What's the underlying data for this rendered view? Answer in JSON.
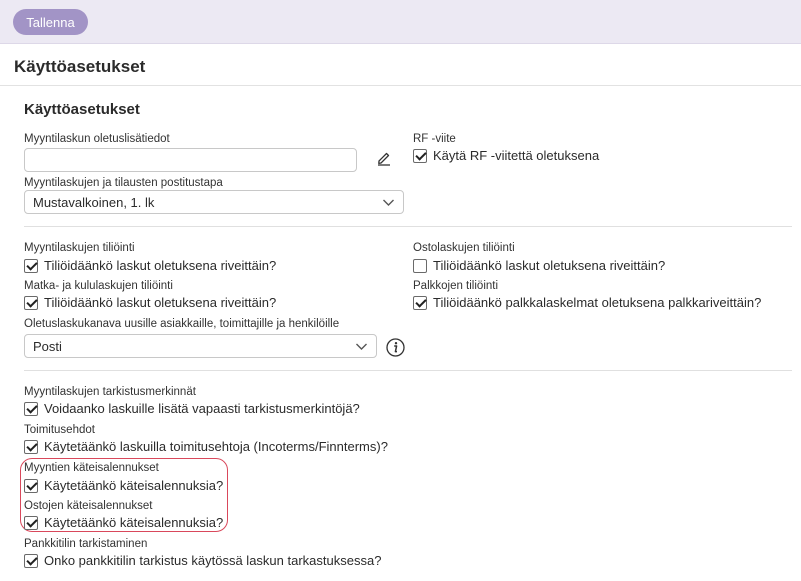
{
  "toolbar": {
    "save_label": "Tallenna"
  },
  "page": {
    "title": "Käyttöasetukset"
  },
  "section": {
    "title": "Käyttöasetukset"
  },
  "invoice_defaults": {
    "additional_info_label": "Myyntilaskun oletuslisätiedot",
    "additional_info_value": "",
    "postal_method_label": "Myyntilaskujen ja tilausten postitustapa",
    "postal_method_value": "Mustavalkoinen, 1. lk",
    "rf_label": "RF -viite",
    "rf_checkbox": "Käytä RF -viitettä oletuksena",
    "rf_checked": true
  },
  "accounting": {
    "sales_label": "Myyntilaskujen tiliöinti",
    "sales_checkbox": "Tiliöidäänkö laskut oletuksena riveittäin?",
    "sales_checked": true,
    "purchase_label": "Ostolaskujen tiliöinti",
    "purchase_checkbox": "Tiliöidäänkö laskut oletuksena riveittäin?",
    "purchase_checked": false,
    "travel_label": "Matka- ja kululaskujen tiliöinti",
    "travel_checkbox": "Tiliöidäänkö laskut oletuksena riveittäin?",
    "travel_checked": true,
    "salary_label": "Palkkojen tiliöinti",
    "salary_checkbox": "Tiliöidäänkö palkkalaskelmat oletuksena palkkariveittäin?",
    "salary_checked": true,
    "channel_label": "Oletuslaskukanava uusille asiakkaille, toimittajille ja henkilöille",
    "channel_value": "Posti"
  },
  "options": {
    "check_marks_label": "Myyntilaskujen tarkistusmerkinnät",
    "check_marks_checkbox": "Voidaanko laskuille lisätä vapaasti tarkistusmerkintöjä?",
    "check_marks_checked": true,
    "delivery_terms_label": "Toimitusehdot",
    "delivery_terms_checkbox": "Käytetäänkö laskuilla toimitusehtoja (Incoterms/Finnterms)?",
    "delivery_terms_checked": true,
    "sales_discount_label": "Myyntien käteisalennukset",
    "sales_discount_checkbox": "Käytetäänkö käteisalennuksia?",
    "sales_discount_checked": true,
    "purchase_discount_label": "Ostojen käteisalennukset",
    "purchase_discount_checkbox": "Käytetäänkö käteisalennuksia?",
    "purchase_discount_checked": true,
    "bank_check_label": "Pankkitilin tarkistaminen",
    "bank_check_checkbox": "Onko pankkitilin tarkistus käytössä laskun tarkastuksessa?",
    "bank_check_checked": true
  },
  "colors": {
    "accent": "#a294c6",
    "highlight": "#d9485b",
    "topbar": "#ece9f3"
  },
  "icons": {
    "edit": "pencil-icon",
    "info": "info-icon",
    "dropdown": "chevron-down-icon"
  }
}
